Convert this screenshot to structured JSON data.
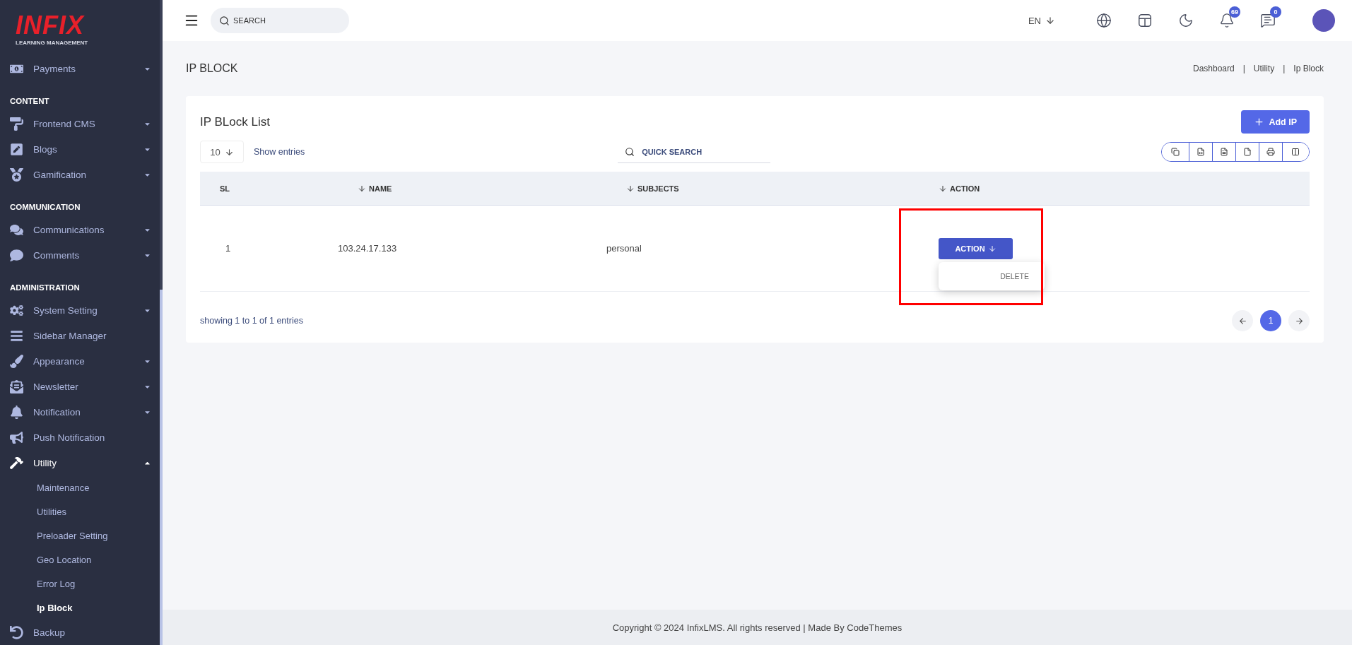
{
  "logo": {
    "brand": "INFIX",
    "tagline": "LEARNING MANAGEMENT"
  },
  "sidebar": {
    "groups": [
      {
        "items": [
          {
            "label": "Payments",
            "selected": false,
            "expanded": false
          }
        ]
      },
      {
        "heading": "CONTENT",
        "items": [
          {
            "label": "Frontend CMS",
            "selected": false,
            "expanded": false
          },
          {
            "label": "Blogs",
            "selected": false,
            "expanded": false
          },
          {
            "label": "Gamification",
            "selected": false,
            "expanded": false
          }
        ]
      },
      {
        "heading": "COMMUNICATION",
        "items": [
          {
            "label": "Communications",
            "selected": false,
            "expanded": false
          },
          {
            "label": "Comments",
            "selected": false,
            "expanded": false
          }
        ]
      },
      {
        "heading": "ADMINISTRATION",
        "items": [
          {
            "label": "System Setting",
            "selected": false,
            "expanded": false
          },
          {
            "label": "Sidebar Manager",
            "selected": false
          },
          {
            "label": "Appearance",
            "selected": false,
            "expanded": false
          },
          {
            "label": "Newsletter",
            "selected": false,
            "expanded": false
          },
          {
            "label": "Notification",
            "selected": false,
            "expanded": false
          },
          {
            "label": "Push Notification",
            "selected": false
          },
          {
            "label": "Utility",
            "selected": true,
            "expanded": true,
            "children": [
              {
                "label": "Maintenance",
                "selected": false
              },
              {
                "label": "Utilities",
                "selected": false
              },
              {
                "label": "Preloader Setting",
                "selected": false
              },
              {
                "label": "Geo Location",
                "selected": false
              },
              {
                "label": "Error Log",
                "selected": false
              },
              {
                "label": "Ip Block",
                "selected": true
              }
            ]
          },
          {
            "label": "Backup",
            "selected": false
          }
        ]
      }
    ]
  },
  "topbar": {
    "search": {
      "placeholder": "SEARCH"
    },
    "language": "EN",
    "notifications_badge": "69",
    "messages_badge": "0"
  },
  "page": {
    "title": "IP BLOCK",
    "breadcrumb": {
      "separator": "|",
      "items": [
        "Dashboard",
        "Utility",
        "Ip Block"
      ]
    }
  },
  "card": {
    "title": "IP BLock List",
    "add_button": "Add IP",
    "entries": {
      "value": "10",
      "label": "Show entries"
    },
    "quick_search": {
      "placeholder": "QUICK SEARCH"
    },
    "table": {
      "columns": [
        {
          "label": "SL",
          "sortable": false
        },
        {
          "label": "NAME",
          "sortable": true
        },
        {
          "label": "SUBJECTS",
          "sortable": true
        },
        {
          "label": "ACTION",
          "sortable": true
        }
      ],
      "rows": [
        {
          "sl": "1",
          "name": "103.24.17.133",
          "subjects": "personal",
          "action": {
            "label": "ACTION",
            "open": true,
            "items": [
              "DELETE"
            ]
          }
        }
      ]
    },
    "summary": "showing 1 to 1 of 1 entries",
    "pagination": {
      "pages": [
        {
          "label": "1",
          "selected": true
        }
      ]
    }
  },
  "footer": "Copyright © 2024 InfixLMS. All rights reserved | Made By CodeThemes"
}
